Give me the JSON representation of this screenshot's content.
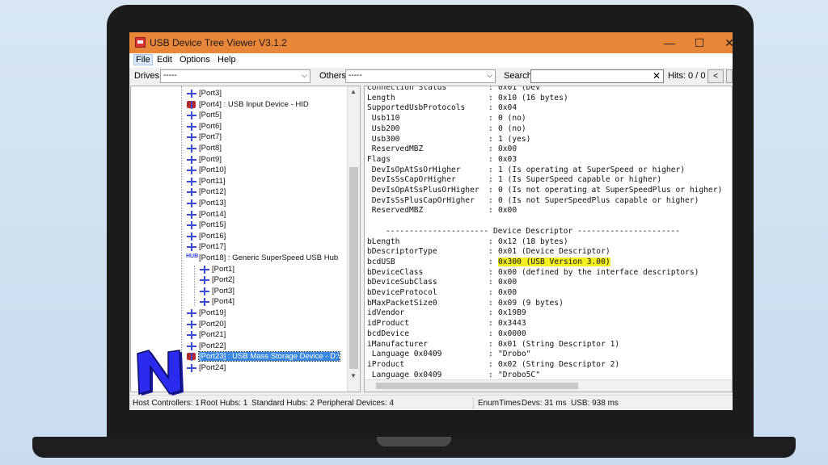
{
  "window": {
    "title": "USB Device Tree Viewer V3.1.2"
  },
  "titlebar": {
    "minimize_glyph": "—",
    "maximize_glyph": "☐",
    "close_glyph": "✕"
  },
  "menu": {
    "file": "File",
    "edit": "Edit",
    "options": "Options",
    "help": "Help"
  },
  "toolbar": {
    "drives_label": "Drives:",
    "drives_value": "-----",
    "others_label": "Others:",
    "others_value": "-----",
    "search_label": "Search:",
    "search_value": "",
    "hits": "Hits: 0 / 0",
    "prev_glyph": "<"
  },
  "tree": [
    {
      "label": "[Port3]",
      "icon": "usb-port-icon"
    },
    {
      "label": "[Port4] : USB Input Device - HID",
      "icon": "usb-device-icon"
    },
    {
      "label": "[Port5]",
      "icon": "usb-port-icon"
    },
    {
      "label": "[Port6]",
      "icon": "usb-port-icon"
    },
    {
      "label": "[Port7]",
      "icon": "usb-port-icon"
    },
    {
      "label": "[Port8]",
      "icon": "usb-port-icon"
    },
    {
      "label": "[Port9]",
      "icon": "usb-port-icon"
    },
    {
      "label": "[Port10]",
      "icon": "usb-port-icon"
    },
    {
      "label": "[Port11]",
      "icon": "usb-port-icon"
    },
    {
      "label": "[Port12]",
      "icon": "usb-port-icon"
    },
    {
      "label": "[Port13]",
      "icon": "usb-port-icon"
    },
    {
      "label": "[Port14]",
      "icon": "usb-port-icon"
    },
    {
      "label": "[Port15]",
      "icon": "usb-port-icon"
    },
    {
      "label": "[Port16]",
      "icon": "usb-port-icon"
    },
    {
      "label": "[Port17]",
      "icon": "usb-port-icon"
    },
    {
      "label": "[Port18] : Generic SuperSpeed USB Hub",
      "icon": "usb-hub-icon"
    },
    {
      "label": "[Port1]",
      "icon": "usb-port-icon"
    },
    {
      "label": "[Port2]",
      "icon": "usb-port-icon"
    },
    {
      "label": "[Port3]",
      "icon": "usb-port-icon"
    },
    {
      "label": "[Port4]",
      "icon": "usb-port-icon"
    },
    {
      "label": "[Port19]",
      "icon": "usb-port-icon"
    },
    {
      "label": "[Port20]",
      "icon": "usb-port-icon"
    },
    {
      "label": "[Port21]",
      "icon": "usb-port-icon"
    },
    {
      "label": "[Port22]",
      "icon": "usb-port-icon"
    },
    {
      "label": "[Port23] : USB Mass Storage Device - D:\\",
      "icon": "usb-device-icon",
      "selected": true
    },
    {
      "label": "[Port24]",
      "icon": "usb-port-icon"
    }
  ],
  "details": [
    {
      "k": "Connection Status",
      "c": ":",
      "v": "0x01 (Dev"
    },
    {
      "k": "Length",
      "c": ":",
      "v": "0x10 (16 bytes)"
    },
    {
      "k": "SupportedUsbProtocols",
      "c": ":",
      "v": "0x04"
    },
    {
      "k": " Usb110",
      "c": ":",
      "v": "0 (no)"
    },
    {
      "k": " Usb200",
      "c": ":",
      "v": "0 (no)"
    },
    {
      "k": " Usb300",
      "c": ":",
      "v": "1 (yes)"
    },
    {
      "k": " ReservedMBZ",
      "c": ":",
      "v": "0x00"
    },
    {
      "k": "Flags",
      "c": ":",
      "v": "0x03"
    },
    {
      "k": " DevIsOpAtSsOrHigher",
      "c": ":",
      "v": "1 (Is operating at SuperSpeed or higher)"
    },
    {
      "k": " DevIsSsCapOrHigher",
      "c": ":",
      "v": "1 (Is SuperSpeed capable or higher)"
    },
    {
      "k": " DevIsOpAtSsPlusOrHigher",
      "c": ":",
      "v": "0 (Is not operating at SuperSpeedPlus or higher)"
    },
    {
      "k": " DevIsSsPlusCapOrHigher",
      "c": ":",
      "v": "0 (Is not SuperSpeedPlus capable or higher)"
    },
    {
      "k": " ReservedMBZ",
      "c": ":",
      "v": "0x00"
    },
    {
      "k": "",
      "c": "",
      "v": ""
    },
    {
      "k": "    ---------------------- Device Descriptor ----------------------",
      "c": "",
      "v": ""
    },
    {
      "k": "bLength",
      "c": ":",
      "v": "0x12 (18 bytes)"
    },
    {
      "k": "bDescriptorType",
      "c": ":",
      "v": "0x01 (Device Descriptor)"
    },
    {
      "k": "bcdUSB",
      "c": ":",
      "v": "0x300 (USB Version 3.00)",
      "highlight": true
    },
    {
      "k": "bDeviceClass",
      "c": ":",
      "v": "0x00 (defined by the interface descriptors)"
    },
    {
      "k": "bDeviceSubClass",
      "c": ":",
      "v": "0x00"
    },
    {
      "k": "bDeviceProtocol",
      "c": ":",
      "v": "0x00"
    },
    {
      "k": "bMaxPacketSize0",
      "c": ":",
      "v": "0x09 (9 bytes)"
    },
    {
      "k": "idVendor",
      "c": ":",
      "v": "0x19B9"
    },
    {
      "k": "idProduct",
      "c": ":",
      "v": "0x3443"
    },
    {
      "k": "bcdDevice",
      "c": ":",
      "v": "0x0000"
    },
    {
      "k": "iManufacturer",
      "c": ":",
      "v": "0x01 (String Descriptor 1)"
    },
    {
      "k": " Language 0x0409",
      "c": ":",
      "v": "\"Drobo\""
    },
    {
      "k": "iProduct",
      "c": ":",
      "v": "0x02 (String Descriptor 2)"
    },
    {
      "k": " Language 0x0409",
      "c": ":",
      "v": "\"Drobo5C\""
    }
  ],
  "status": {
    "host_controllers": "Host Controllers: 1",
    "root_hubs": "Root Hubs: 1",
    "standard_hubs": "Standard Hubs: 2",
    "peripheral_devices": "Peripheral Devices: 4",
    "enum_times": "EnumTimes",
    "devs": "Devs: 31 ms",
    "usb": "USB: 938 ms"
  },
  "colors": {
    "titlebar": "#e8863a",
    "selection": "#3a87e0",
    "highlight": "#f4ef21",
    "logo": "#2222dd"
  }
}
